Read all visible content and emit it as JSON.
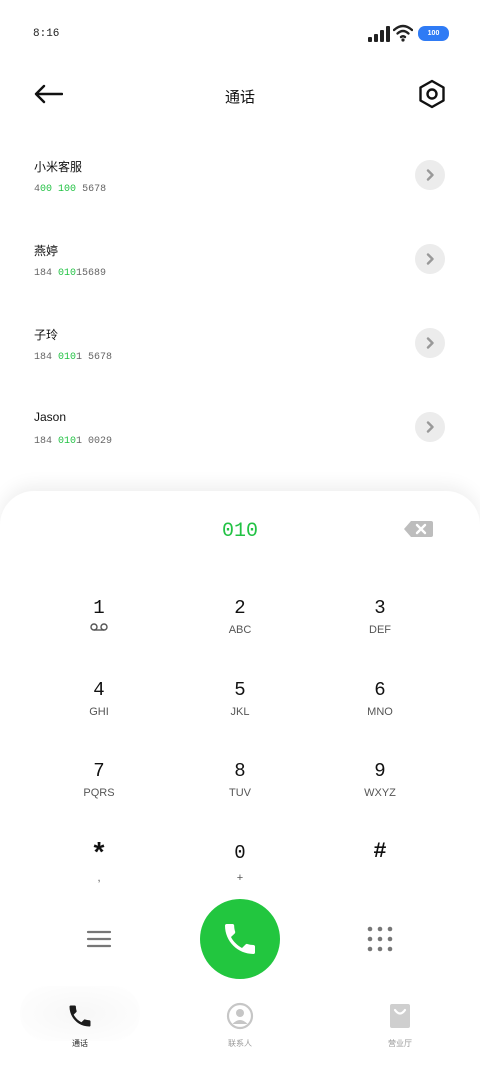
{
  "status_bar": {
    "time": "8:16",
    "battery": "100"
  },
  "header": {
    "title": "通话"
  },
  "contacts": [
    {
      "name": "小米客服",
      "number_parts": [
        "4",
        "00",
        " ",
        "100",
        " 5678"
      ]
    },
    {
      "name": "燕婷",
      "number_parts": [
        "184 ",
        "010",
        "15689",
        "",
        ""
      ]
    },
    {
      "name": "子玲",
      "number_parts": [
        "184 ",
        "010",
        "1 5678",
        "",
        ""
      ]
    },
    {
      "name": "Jason",
      "number_parts": [
        "184 ",
        "010",
        "1 0029",
        "",
        ""
      ]
    }
  ],
  "dialer": {
    "input": "010",
    "keys": [
      {
        "digit": "1",
        "letters": ""
      },
      {
        "digit": "2",
        "letters": "ABC"
      },
      {
        "digit": "3",
        "letters": "DEF"
      },
      {
        "digit": "4",
        "letters": "GHI"
      },
      {
        "digit": "5",
        "letters": "JKL"
      },
      {
        "digit": "6",
        "letters": "MNO"
      },
      {
        "digit": "7",
        "letters": "PQRS"
      },
      {
        "digit": "8",
        "letters": "TUV"
      },
      {
        "digit": "9",
        "letters": "WXYZ"
      },
      {
        "digit": "*",
        "letters": ","
      },
      {
        "digit": "0",
        "letters": "+"
      },
      {
        "digit": "#",
        "letters": ""
      }
    ]
  },
  "nav": {
    "items": [
      {
        "label": "通话",
        "icon": "phone-icon",
        "active": true
      },
      {
        "label": "联系人",
        "icon": "person-icon",
        "active": false
      },
      {
        "label": "营业厅",
        "icon": "shopping-bag-icon",
        "active": false
      }
    ]
  },
  "colors": {
    "accent": "#22c244",
    "call_button": "#22c63f",
    "battery": "#2f7bf5"
  }
}
